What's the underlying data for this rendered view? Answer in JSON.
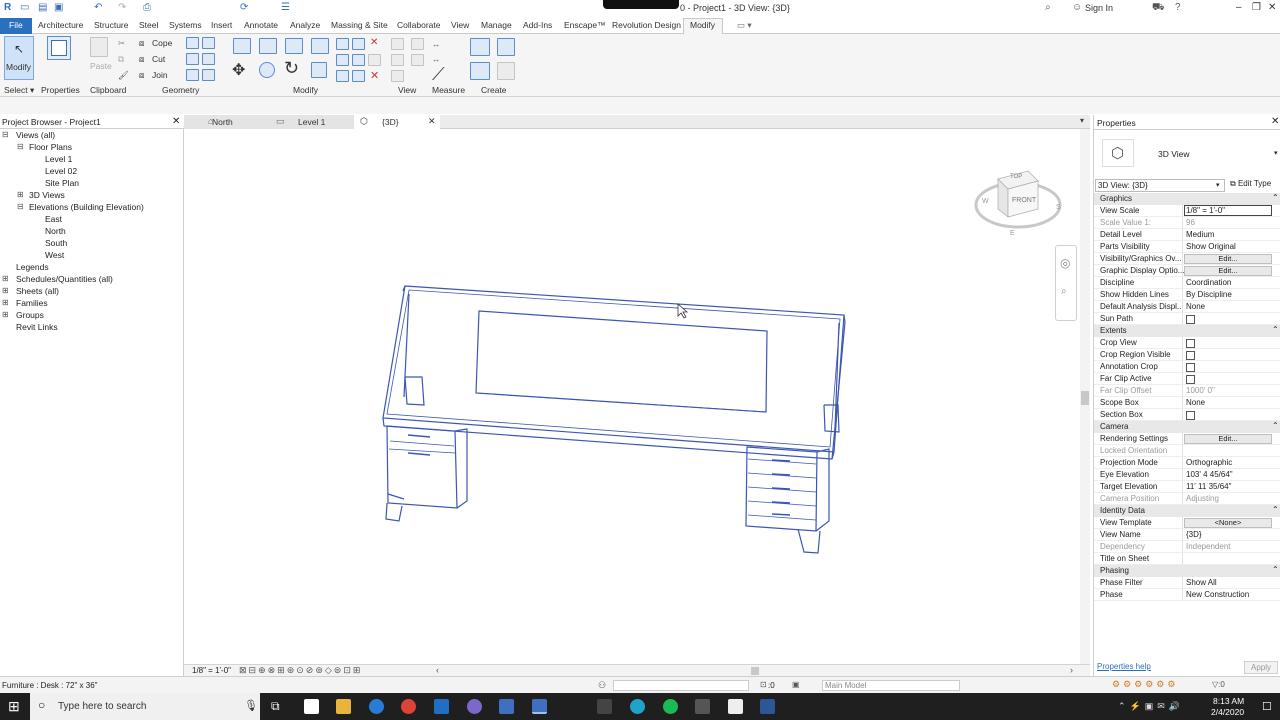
{
  "titlebar": {
    "title": "0 - Project1 - 3D View: {3D}",
    "sign_in": "Sign In"
  },
  "ribbon_tabs": [
    "File",
    "Architecture",
    "Structure",
    "Steel",
    "Systems",
    "Insert",
    "Annotate",
    "Analyze",
    "Massing & Site",
    "Collaborate",
    "View",
    "Manage",
    "Add-Ins",
    "Enscape™",
    "Revolution Design",
    "Modify"
  ],
  "ribbon": {
    "modify_label": "Modify",
    "select_label": "Select",
    "properties_label": "Properties",
    "clipboard_label": "Clipboard",
    "paste_label": "Paste",
    "cope_label": "Cope",
    "cut_label": "Cut",
    "join_label": "Join",
    "geometry_label": "Geometry",
    "modify_group_label": "Modify",
    "view_label": "View",
    "measure_label": "Measure",
    "create_label": "Create"
  },
  "project_browser": {
    "title": "Project Browser - Project1",
    "items": [
      {
        "label": "Views (all)",
        "level": 0,
        "toggle": "⊟"
      },
      {
        "label": "Floor Plans",
        "level": 1,
        "toggle": "⊟"
      },
      {
        "label": "Level 1",
        "level": 2,
        "toggle": ""
      },
      {
        "label": "Level 02",
        "level": 2,
        "toggle": ""
      },
      {
        "label": "Site Plan",
        "level": 2,
        "toggle": ""
      },
      {
        "label": "3D Views",
        "level": 1,
        "toggle": "⊞"
      },
      {
        "label": "Elevations (Building Elevation)",
        "level": 1,
        "toggle": "⊟"
      },
      {
        "label": "East",
        "level": 2,
        "toggle": ""
      },
      {
        "label": "North",
        "level": 2,
        "toggle": ""
      },
      {
        "label": "South",
        "level": 2,
        "toggle": ""
      },
      {
        "label": "West",
        "level": 2,
        "toggle": ""
      },
      {
        "label": "Legends",
        "level": 0,
        "toggle": ""
      },
      {
        "label": "Schedules/Quantities (all)",
        "level": 0,
        "toggle": "⊞"
      },
      {
        "label": "Sheets (all)",
        "level": 0,
        "toggle": "⊞"
      },
      {
        "label": "Families",
        "level": 0,
        "toggle": "⊞"
      },
      {
        "label": "Groups",
        "level": 0,
        "toggle": "⊞"
      },
      {
        "label": "Revit Links",
        "level": 0,
        "toggle": ""
      }
    ]
  },
  "view_tabs": [
    {
      "label": "North"
    },
    {
      "label": "Level 1"
    },
    {
      "label": "{3D}"
    }
  ],
  "viewcube": {
    "top": "TOP",
    "front": "FRONT"
  },
  "view_control": {
    "scale": "1/8\" = 1'-0\""
  },
  "properties": {
    "title": "Properties",
    "type_name": "3D View",
    "selector": "3D View: {3D}",
    "edit_type": "Edit Type",
    "help": "Properties help",
    "apply": "Apply",
    "rows": [
      {
        "kind": "section",
        "name": "Graphics"
      },
      {
        "kind": "value",
        "name": "View Scale",
        "value": "1/8\" = 1'-0\""
      },
      {
        "kind": "value",
        "name": "Scale Value    1:",
        "value": "96",
        "dim": true
      },
      {
        "kind": "value",
        "name": "Detail Level",
        "value": "Medium"
      },
      {
        "kind": "value",
        "name": "Parts Visibility",
        "value": "Show Original"
      },
      {
        "kind": "button",
        "name": "Visibility/Graphics Ov...",
        "value": "Edit..."
      },
      {
        "kind": "button",
        "name": "Graphic Display Optio...",
        "value": "Edit..."
      },
      {
        "kind": "value",
        "name": "Discipline",
        "value": "Coordination"
      },
      {
        "kind": "value",
        "name": "Show Hidden Lines",
        "value": "By Discipline"
      },
      {
        "kind": "value",
        "name": "Default Analysis Displ...",
        "value": "None"
      },
      {
        "kind": "check",
        "name": "Sun Path",
        "value": ""
      },
      {
        "kind": "section",
        "name": "Extents"
      },
      {
        "kind": "check",
        "name": "Crop View",
        "value": ""
      },
      {
        "kind": "check",
        "name": "Crop Region Visible",
        "value": ""
      },
      {
        "kind": "check",
        "name": "Annotation Crop",
        "value": ""
      },
      {
        "kind": "check",
        "name": "Far Clip Active",
        "value": ""
      },
      {
        "kind": "value",
        "name": "Far Clip Offset",
        "value": "1000'  0\"",
        "dim": true
      },
      {
        "kind": "value",
        "name": "Scope Box",
        "value": "None"
      },
      {
        "kind": "check",
        "name": "Section Box",
        "value": ""
      },
      {
        "kind": "section",
        "name": "Camera"
      },
      {
        "kind": "button",
        "name": "Rendering Settings",
        "value": "Edit..."
      },
      {
        "kind": "value",
        "name": "Locked Orientation",
        "value": "",
        "dim": true
      },
      {
        "kind": "value",
        "name": "Projection Mode",
        "value": "Orthographic"
      },
      {
        "kind": "value",
        "name": "Eye Elevation",
        "value": "103'  4 45/64\""
      },
      {
        "kind": "value",
        "name": "Target Elevation",
        "value": "11'  11 35/64\""
      },
      {
        "kind": "value",
        "name": "Camera Position",
        "value": "Adjusting",
        "dim": true
      },
      {
        "kind": "section",
        "name": "Identity Data"
      },
      {
        "kind": "button",
        "name": "View Template",
        "value": "<None>"
      },
      {
        "kind": "value",
        "name": "View Name",
        "value": "{3D}"
      },
      {
        "kind": "value",
        "name": "Dependency",
        "value": "Independent",
        "dim": true
      },
      {
        "kind": "value",
        "name": "Title on Sheet",
        "value": ""
      },
      {
        "kind": "section",
        "name": "Phasing"
      },
      {
        "kind": "value",
        "name": "Phase Filter",
        "value": "Show All"
      },
      {
        "kind": "value",
        "name": "Phase",
        "value": "New Construction"
      }
    ]
  },
  "status": {
    "selection": "Furniture : Desk : 72\" x 36\"",
    "model": "Main Model",
    "zero": ":0"
  },
  "taskbar": {
    "search": "Type here to search",
    "time": "8:13 AM",
    "date": "2/4/2020"
  },
  "colors": {
    "accent": "#2b6fbf",
    "desk_line": "#3b56b5"
  }
}
